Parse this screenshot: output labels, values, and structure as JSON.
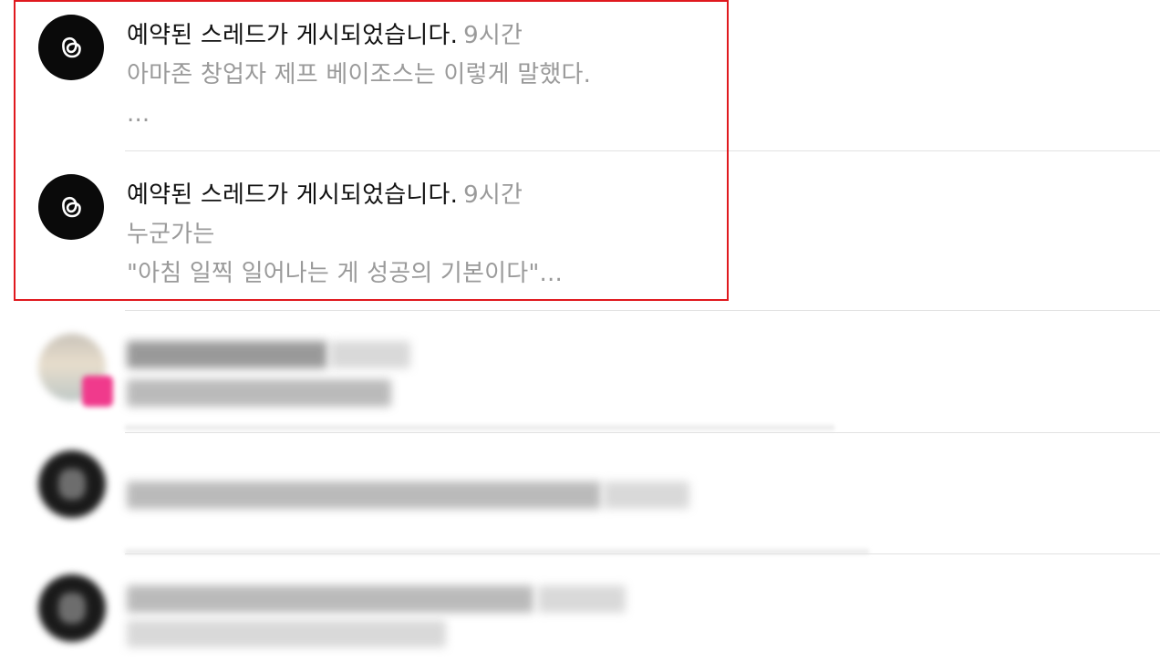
{
  "notifications": [
    {
      "title": "예약된 스레드가 게시되었습니다.",
      "time": "9시간",
      "body_lines": [
        "아마존 창업자 제프 베이조스는 이렇게 말했다.",
        "..."
      ],
      "icon": "threads-logo-icon"
    },
    {
      "title": "예약된 스레드가 게시되었습니다.",
      "time": "9시간",
      "body_lines": [
        "누군가는",
        "\"아침 일찍 일어나는 게 성공의 기본이다\"..."
      ],
      "icon": "threads-logo-icon"
    }
  ],
  "colors": {
    "highlight_border": "#e0191e",
    "title_text": "#111111",
    "secondary_text": "#9a9a9a",
    "divider": "#e2e2e2",
    "avatar_bg": "#0a0a0a",
    "badge_pink": "#f03a8c"
  }
}
